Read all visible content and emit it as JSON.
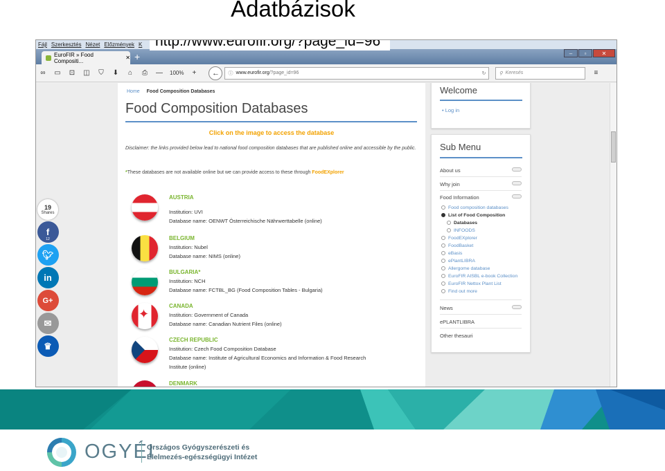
{
  "slide": {
    "title": "Adatbázisok",
    "url_caption": "http://www.eurofir.org/?page_id=96"
  },
  "browser": {
    "menu": [
      "Fájl",
      "Szerkesztés",
      "Nézet",
      "Előzmények",
      "K"
    ],
    "tab_title": "EuroFIR » Food Compositi...",
    "zoom": "100%",
    "url_host": "www.eurofir.org",
    "url_path": "/?page_id=96",
    "search_placeholder": "Keresés"
  },
  "page": {
    "breadcrumb_home": "Home",
    "breadcrumb_current": "Food Composition Databases",
    "heading": "Food Composition Databases",
    "click_note": "Click on the image to access the database",
    "disclaimer": "Disclaimer: the links provided below lead to national food composition databases that are published online and accessible by the public.",
    "fe_note_star": "*",
    "fe_note_text": "These databases are not available online but we can provide access to these through ",
    "fe_note_link": "FoodEXplorer",
    "countries": [
      {
        "name": "AUSTRIA",
        "institution": "Institution: UVI",
        "database": "Database name: OENWT Österreichische Nährwerttabelle (online)"
      },
      {
        "name": "BELGIUM",
        "institution": "Institution: Nubel",
        "database": "Database name: NIMS (online)"
      },
      {
        "name": "BULGARIA*",
        "institution": "Institution: NCH",
        "database": "Database name: FCTBL_BG (Food Composition Tables - Bulgaria)"
      },
      {
        "name": "CANADA",
        "institution": "Institution: Government of Canada",
        "database": "Database name: Canadian Nutrient Files (online)"
      },
      {
        "name": "CZECH REPUBLIC",
        "institution": "Institution: Czech Food Composition Database",
        "database": "Database name: Institute of Agricultural Economics and Information & Food Research",
        "database2": "Institute (online)"
      },
      {
        "name": "DENMARK"
      }
    ]
  },
  "sidebar": {
    "welcome_title": "Welcome",
    "login": "Log in",
    "submenu_title": "Sub Menu",
    "items": [
      "About us",
      "Why join",
      "Food Information",
      "News",
      "ePLANTLIBRA",
      "Other thesauri"
    ],
    "food_info_sub": [
      "Food composition databases",
      "List of Food Composition",
      "Databases",
      "INFOODS",
      "FoodEXplorer",
      "FoodBasket",
      "eBasis",
      "ePlantLIBRA",
      "Allergome database",
      "EuroFIR AISBL e-book Collection",
      "EuroFIR Nettox Plant List",
      "Find out more"
    ]
  },
  "shares": {
    "count": "19",
    "label": "Shares",
    "facebook_count": "12"
  },
  "footer": {
    "logo_word": "OGYÉI",
    "org_line1": "Országos Gyógyszerészeti és",
    "org_line2": "Élelmezés-egészségügyi Intézet"
  },
  "colors": {
    "accent_blue": "#5b8fc7",
    "country_green": "#7ab52f",
    "highlight_orange": "#f2a200",
    "band_teal": "#0f8f8a"
  }
}
